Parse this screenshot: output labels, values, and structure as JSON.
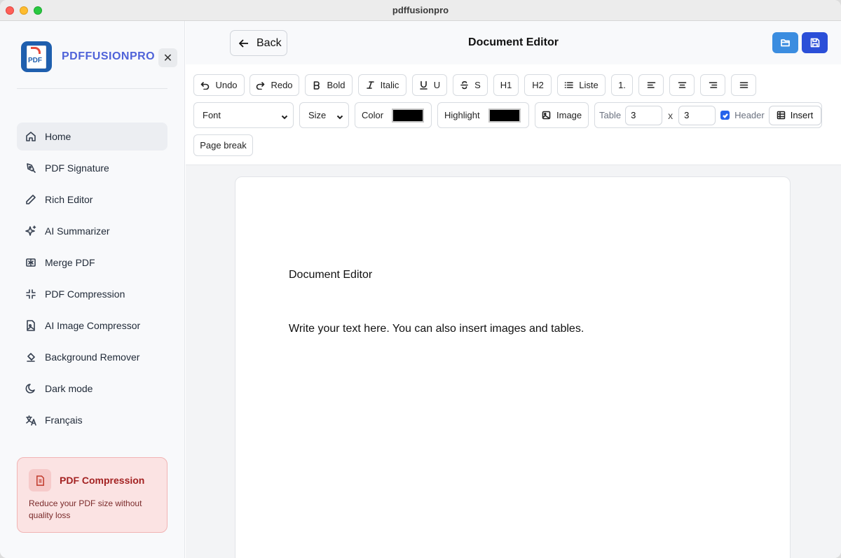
{
  "window": {
    "title": "pdffusionpro"
  },
  "brand": {
    "name": "PDFFUSIONPRO",
    "logo_text": "PDF",
    "close_label": "✕"
  },
  "sidebar": {
    "items": [
      {
        "label": "Home",
        "icon": "home-icon",
        "active": true
      },
      {
        "label": "PDF Signature",
        "icon": "pen-tool-icon"
      },
      {
        "label": "Rich Editor",
        "icon": "pencil-icon"
      },
      {
        "label": "AI Summarizer",
        "icon": "sparkles-icon"
      },
      {
        "label": "Merge PDF",
        "icon": "merge-icon"
      },
      {
        "label": "PDF Compression",
        "icon": "shrink-icon"
      },
      {
        "label": "AI Image Compressor",
        "icon": "file-image-icon"
      },
      {
        "label": "Background Remover",
        "icon": "eraser-icon"
      },
      {
        "label": "Dark mode",
        "icon": "moon-icon"
      },
      {
        "label": "Français",
        "icon": "languages-icon"
      }
    ],
    "promo": {
      "title": "PDF Compression",
      "text": "Reduce your PDF size without quality loss",
      "icon": "file-text-icon",
      "accent": "#a32222"
    }
  },
  "header": {
    "back_label": "Back",
    "title": "Document Editor"
  },
  "toolbar": {
    "undo": "Undo",
    "redo": "Redo",
    "bold": "Bold",
    "italic": "Italic",
    "underline": "U",
    "strike": "S",
    "h1": "H1",
    "h2": "H2",
    "list": "Liste",
    "ordered": "1.",
    "font_select": "Font",
    "size_select": "Size",
    "color_label": "Color",
    "color_value": "#000000",
    "highlight_label": "Highlight",
    "highlight_value": "#000000",
    "image_label": "Image",
    "table_label": "Table",
    "table_rows": "3",
    "table_x": "x",
    "table_cols": "3",
    "header_label": "Header",
    "header_checked": true,
    "insert_label": "Insert",
    "page_break": "Page break"
  },
  "document": {
    "heading": "Document Editor",
    "body": "Write your text here. You can also insert images and tables."
  },
  "colors": {
    "brand": "#4f63d9",
    "open_button": "#3b8de0",
    "save_button": "#2b4fd8"
  }
}
